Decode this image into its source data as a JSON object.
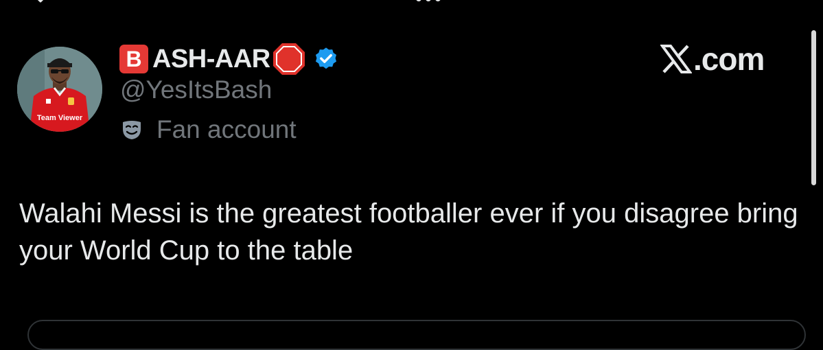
{
  "header": {
    "icons": [
      "chevron-down-icon",
      "more-dots-icon"
    ]
  },
  "tweet": {
    "author": {
      "badge_letter": "B",
      "display_name": "ASH-AAR",
      "handle": "@YesItsBash",
      "label": "Fan account",
      "avatar_jersey_text": "Team Viewer",
      "icons": [
        "letter-b-emoji-icon",
        "stop-sign-emoji-icon",
        "verified-badge-icon",
        "mask-icon"
      ]
    },
    "source": {
      "domain": ".com",
      "logo_icon": "x-logo-icon"
    },
    "text": "Walahi Messi is the greatest footballer ever if you disagree bring your World Cup to the table"
  },
  "colors": {
    "background": "#000000",
    "primary_text": "#e7e9ea",
    "secondary_text": "#71767b",
    "verified_blue": "#1d9bf0",
    "badge_red": "#e53935",
    "border": "#2f3336"
  }
}
